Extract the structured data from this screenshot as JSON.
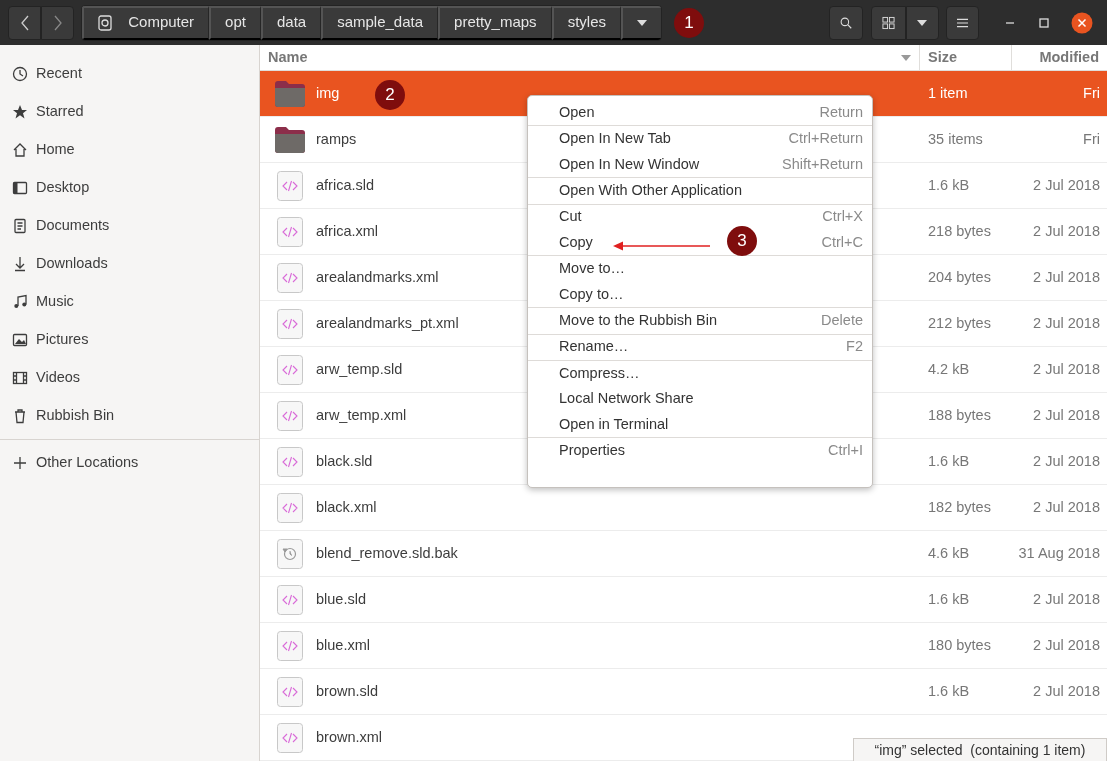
{
  "header": {
    "path": [
      {
        "label": "Computer",
        "kind": "drive"
      },
      {
        "label": "opt"
      },
      {
        "label": "data"
      },
      {
        "label": "sample_data"
      },
      {
        "label": "pretty_maps"
      },
      {
        "label": "styles"
      }
    ]
  },
  "sidebar": {
    "items": [
      {
        "label": "Recent"
      },
      {
        "label": "Starred"
      },
      {
        "label": "Home"
      },
      {
        "label": "Desktop"
      },
      {
        "label": "Documents"
      },
      {
        "label": "Downloads"
      },
      {
        "label": "Music"
      },
      {
        "label": "Pictures"
      },
      {
        "label": "Videos"
      },
      {
        "label": "Rubbish Bin"
      }
    ],
    "other": {
      "label": "Other Locations"
    }
  },
  "table": {
    "columns": [
      "Name",
      "Size",
      "Modified"
    ],
    "rows": [
      {
        "name": "img",
        "kind": "folder",
        "size": "1 item",
        "modified": "Fri",
        "selected": true
      },
      {
        "name": "ramps",
        "kind": "folder",
        "size": "35 items",
        "modified": "Fri",
        "selected": false
      },
      {
        "name": "africa.sld",
        "kind": "code",
        "size": "1.6 kB",
        "modified": "2 Jul 2018",
        "selected": false
      },
      {
        "name": "africa.xml",
        "kind": "code",
        "size": "218 bytes",
        "modified": "2 Jul 2018",
        "selected": false
      },
      {
        "name": "arealandmarks.xml",
        "kind": "code",
        "size": "204 bytes",
        "modified": "2 Jul 2018",
        "selected": false
      },
      {
        "name": "arealandmarks_pt.xml",
        "kind": "code",
        "size": "212 bytes",
        "modified": "2 Jul 2018",
        "selected": false
      },
      {
        "name": "arw_temp.sld",
        "kind": "code",
        "size": "4.2 kB",
        "modified": "2 Jul 2018",
        "selected": false
      },
      {
        "name": "arw_temp.xml",
        "kind": "code",
        "size": "188 bytes",
        "modified": "2 Jul 2018",
        "selected": false
      },
      {
        "name": "black.sld",
        "kind": "code",
        "size": "1.6 kB",
        "modified": "2 Jul 2018",
        "selected": false
      },
      {
        "name": "black.xml",
        "kind": "code",
        "size": "182 bytes",
        "modified": "2 Jul 2018",
        "selected": false
      },
      {
        "name": "blend_remove.sld.bak",
        "kind": "backup",
        "size": "4.6 kB",
        "modified": "31 Aug 2018",
        "selected": false
      },
      {
        "name": "blue.sld",
        "kind": "code",
        "size": "1.6 kB",
        "modified": "2 Jul 2018",
        "selected": false
      },
      {
        "name": "blue.xml",
        "kind": "code",
        "size": "180 bytes",
        "modified": "2 Jul 2018",
        "selected": false
      },
      {
        "name": "brown.sld",
        "kind": "code",
        "size": "1.6 kB",
        "modified": "2 Jul 2018",
        "selected": false
      },
      {
        "name": "brown.xml",
        "kind": "code",
        "selected": false
      }
    ]
  },
  "context_menu": {
    "sections": [
      [
        {
          "label": "Open",
          "shortcut": "Return"
        }
      ],
      [
        {
          "label": "Open In New Tab",
          "shortcut": "Ctrl+Return"
        },
        {
          "label": "Open In New Window",
          "shortcut": "Shift+Return"
        }
      ],
      [
        {
          "label": "Open With Other Application"
        }
      ],
      [
        {
          "label": "Cut",
          "shortcut": "Ctrl+X"
        },
        {
          "label": "Copy",
          "shortcut": "Ctrl+C"
        }
      ],
      [
        {
          "label": "Move to…"
        },
        {
          "label": "Copy to…"
        }
      ],
      [
        {
          "label": "Move to the Rubbish Bin",
          "shortcut": "Delete"
        }
      ],
      [
        {
          "label": "Rename…",
          "shortcut": "F2"
        }
      ],
      [
        {
          "label": "Compress…"
        },
        {
          "label": "Local Network Share"
        },
        {
          "label": "Open in Terminal"
        }
      ],
      [
        {
          "label": "Properties",
          "shortcut": "Ctrl+I"
        }
      ]
    ]
  },
  "status_bar": "“img” selected  (containing 1 item)",
  "annotations": [
    {
      "label": "1"
    },
    {
      "label": "2"
    },
    {
      "label": "3"
    }
  ]
}
